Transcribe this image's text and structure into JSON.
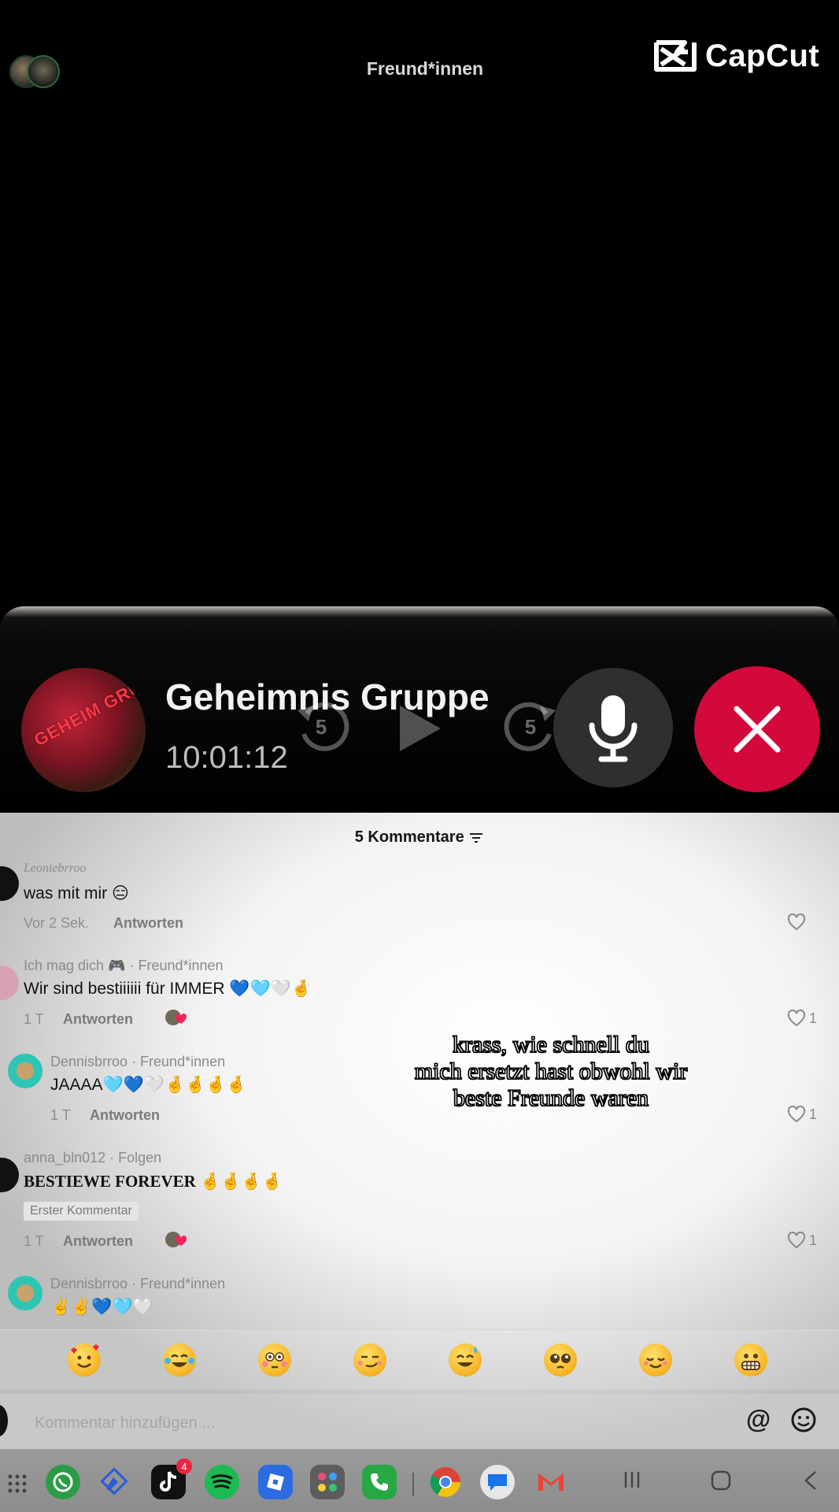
{
  "top_bar": {
    "title": "Freund*innen",
    "brand": "CapCut"
  },
  "call": {
    "group_name": "Geheimnis Gruppe",
    "timer": "10:01:12",
    "avatar_text": "GEHEIM GRUPPE",
    "skip_back": "5",
    "skip_forward": "5"
  },
  "comments": {
    "header": "5 Kommentare",
    "items": [
      {
        "user": "Leoniebrroo",
        "text": "was mit mir 😑",
        "time": "Vor 2 Sek.",
        "reply": "Antworten",
        "likes": ""
      },
      {
        "user": "Ich mag dich 🎮 · Freund*innen",
        "text": "Wir sind bestiiiiii für IMMER 💙🩵🤍🤞",
        "time": "1 T",
        "reply": "Antworten",
        "likes": "1"
      },
      {
        "user": "Dennisbrroo · Freund*innen",
        "text": "JAAAA🩵💙🤍🤞🤞🤞🤞",
        "time": "1 T",
        "reply": "Antworten",
        "likes": "1"
      },
      {
        "user": "anna_bln012 · Folgen",
        "text": "BESTIEWE FOREVER 🤞🤞🤞🤞",
        "badge": "Erster Kommentar",
        "time": "1 T",
        "reply": "Antworten",
        "likes": "1"
      },
      {
        "user": "Dennisbrroo · Freund*innen",
        "text": "✌️✌️💙🩵🤍"
      }
    ]
  },
  "subtitle": {
    "line1": "krass, wie schnell du",
    "line2": "mich ersetzt hast obwohl wir",
    "line3": "beste Freunde waren"
  },
  "emoji_bar": [
    "smiling-hearts",
    "tears-of-joy",
    "flushed",
    "smirk",
    "sweat-smile",
    "pleading",
    "relieved",
    "grimacing"
  ],
  "input": {
    "placeholder": "Kommentar hinzufügen ...",
    "mention": "@"
  },
  "taskbar": {
    "apps": [
      "whatsapp",
      "edit",
      "tiktok",
      "spotify",
      "roblox",
      "folder",
      "phone",
      "chrome",
      "messages",
      "gmail"
    ],
    "tiktok_badge": "4"
  },
  "colors": {
    "end_call": "#d3083b",
    "accent_teal": "#2fc5b5"
  }
}
